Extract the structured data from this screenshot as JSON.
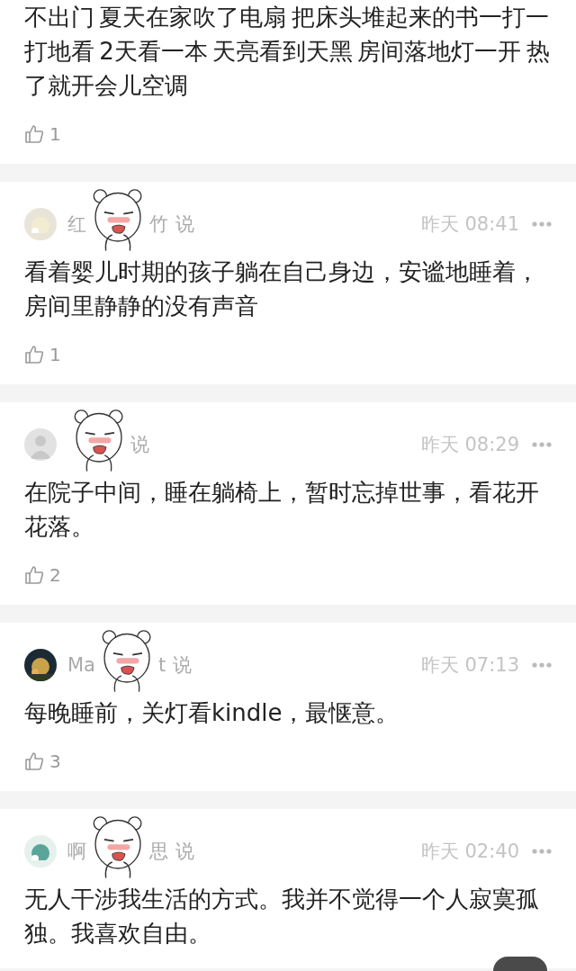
{
  "comments": [
    {
      "text": "不出门 夏天在家吹了电扇 把床头堆起来的书一打一打地看 2天看一本 天亮看到天黑 房间落地灯一开 热了就开会儿空调",
      "likes": "1",
      "sticker": false
    },
    {
      "name_start": "红",
      "name_end": "竹",
      "said": "说",
      "time": "昨天 08:41",
      "text": "看着婴儿时期的孩子躺在自己身边，安谧地睡着，房间里静静的没有声音",
      "likes": "1",
      "sticker": true
    },
    {
      "avatar": {
        "kind": "default"
      },
      "said": "说",
      "time": "昨天 08:29",
      "text": "在院子中间，睡在躺椅上，暂时忘掉世事，看花开花落。",
      "likes": "2",
      "sticker": true
    },
    {
      "name_start": "Ma",
      "name_end": "t",
      "said": "说",
      "time": "昨天 07:13",
      "text": "每晚睡前，关灯看kindle，最惬意。",
      "likes": "3",
      "sticker": true
    },
    {
      "name_start": "啊",
      "name_end": "思",
      "said": "说",
      "time": "昨天 02:40",
      "text": "无人干涉我生活的方式。我并不觉得一个人寂寞孤独。我喜欢自由。",
      "sticker": true
    }
  ]
}
